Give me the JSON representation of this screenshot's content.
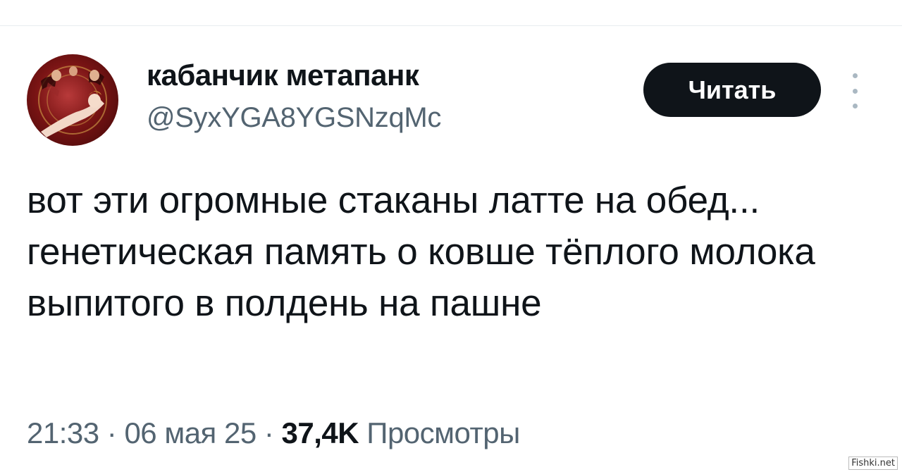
{
  "tweet": {
    "author": {
      "display_name": "кабанчик метапанк",
      "handle": "@SyxYGA8YGSNzqMc",
      "avatar_icon": "avatar-image"
    },
    "follow_label": "Читать",
    "more_icon": "more-vertical-icon",
    "text": "вот эти огромные стаканы латте на обед... генетическая память о ковше тёплого молока выпитого в полдень на пашне",
    "time": "21:33",
    "date": "06 мая 25",
    "separator": " · ",
    "views_count": "37,4K",
    "views_label": "Просмотры"
  },
  "watermark": "Fishki.net",
  "colors": {
    "text": "#0f1419",
    "secondary": "#536471",
    "button_bg": "#0f1419",
    "button_text": "#ffffff",
    "avatar_bg": "#7a1414"
  }
}
